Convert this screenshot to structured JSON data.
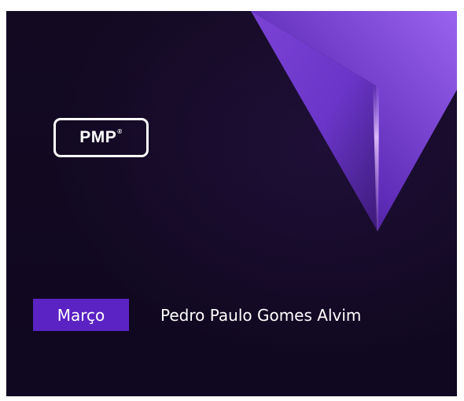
{
  "banner": {
    "logo_text": "PMP",
    "logo_mark": "®",
    "month_label": "Março",
    "author_name": "Pedro Paulo Gomes Alvim",
    "colors": {
      "background": "#12081f",
      "accent": "#5b22c4",
      "triangle_light": "#8a55e6",
      "triangle_dark": "#4a1f9a",
      "text": "#ffffff"
    }
  }
}
